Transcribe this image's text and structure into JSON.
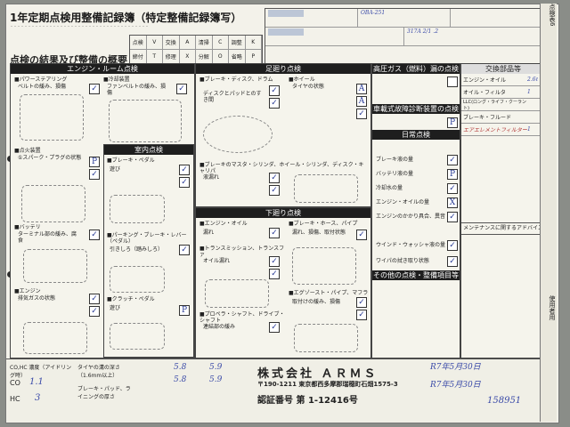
{
  "header": {
    "title": "1年定期点検用整備記録簿（特定整備記録簿写）",
    "subtitle": "点検の結果及び整備の概要",
    "vehicle_no": "OBA-251",
    "plate_hw": "317A",
    "date_hw": "2/1 .2",
    "top_grid": [
      "点検",
      "V",
      "交換",
      "A",
      "清掃",
      "C",
      "調整",
      "K",
      "締付",
      "T",
      "修理",
      "X",
      "分解",
      "O",
      "省略",
      "P"
    ]
  },
  "sections": {
    "engine_room": "エンジン・ルーム点検",
    "interior": "室内点検",
    "suspension": "足廻り点検",
    "undercarriage": "下廻り点検",
    "emissions": "高圧ガス（燃料）漏の点検",
    "diagnostics": "車載式故障診断装置の点検",
    "daily": "日常点検",
    "other": "その他の点検・整備項目等",
    "parts": "交換部品等",
    "advice": "メンテナンスに関するアドバイス"
  },
  "engine_items": [
    {
      "label": "■パワーステアリング",
      "sub": "ベルトの緩み、損傷",
      "mark": "✓"
    },
    {
      "label": "■冷却装置",
      "sub": "ファンベルトの緩み、損傷",
      "mark": "✓"
    },
    {
      "label": "■点火装置",
      "sub": "①スパーク・プラグの状態",
      "mark": "P"
    },
    {
      "label": "■バッテリ",
      "sub": "ターミナル部の緩み、腐食",
      "mark": "✓"
    },
    {
      "label": "■エンジン",
      "sub": "排気ガスの状態",
      "mark": "✓"
    }
  ],
  "interior_items": [
    {
      "label": "■ブレーキ・ペダル",
      "sub": "遊び",
      "mark": "✓"
    },
    {
      "label": "■パーキング・ブレーキ・レバー（ペダル）",
      "sub": "引きしろ（踏みしろ）",
      "mark": "✓"
    },
    {
      "label": "■クラッチ・ペダル",
      "sub": "遊び",
      "mark": "P"
    }
  ],
  "suspension_items": [
    {
      "label": "■ブレーキ・ディスク、ドラム",
      "sub": "ディスクとパッドとのすき間",
      "mark": "✓"
    },
    {
      "label": "■ホイール",
      "sub": "タイヤの状態",
      "mark": "A"
    },
    {
      "label": "■ブレーキのマスタ・シリンダ、ホイール・シリンダ、ディスク・キャリパ",
      "sub": "液漏れ",
      "mark": "✓"
    }
  ],
  "under_items": [
    {
      "label": "■エンジン・オイル",
      "sub": "漏れ",
      "mark": "✓"
    },
    {
      "label": "■ブレーキ・ホース、パイプ",
      "sub": "漏れ、損傷、取付状態",
      "mark": "✓"
    },
    {
      "label": "■トランスミッション、トランスファ",
      "sub": "オイル漏れ",
      "mark": "✓"
    },
    {
      "label": "■プロペラ・シャフト、ドライブ・シャフト",
      "sub": "連結部の緩み",
      "mark": "✓"
    },
    {
      "label": "■エグゾースト・パイプ、マフラ",
      "sub": "取付けの緩み、損傷",
      "mark": "✓"
    }
  ],
  "daily_items": [
    "ブレーキ液の量",
    "バッテリ液の量",
    "冷却水の量",
    "エンジン・オイルの量",
    "エンジンのかかり具合、異音",
    "ウインド・ウォッシャ液の量",
    "ワイパの拭き取り状態"
  ],
  "parts_list": [
    {
      "name": "エンジン・オイル",
      "value": "2.6ℓ"
    },
    {
      "name": "オイル・フィルタ",
      "value": "1"
    },
    {
      "name": "LLC(ロング・ライフ・クーラント)",
      "value": ""
    },
    {
      "name": "ブレーキ・フルード",
      "value": ""
    },
    {
      "name": "エアエレメントフィルター",
      "value": "1"
    }
  ],
  "footer": {
    "company": "株式会社 ＡＲＭＳ",
    "address": "〒190-1211 東京都西多摩郡瑞穂町石畑1575-3",
    "cert": "認証番号 第 1-12416号",
    "date1": "R7年5月30日",
    "date2": "R7年5月30日",
    "mileage": "158951",
    "co_hc_label": "CO,HC 濃度（アイドリング時）",
    "co": "1.1",
    "hc": "3",
    "tire_label": "タイヤの溝の深さ（1.6mm以上）",
    "brake_label": "ブレーキ・パッド、ライニングの厚さ",
    "tire_values": [
      "5.8",
      "5.9",
      "5.8",
      "5.9"
    ]
  },
  "sidebar": {
    "top": "点検表6",
    "bottom": "使用者用"
  }
}
